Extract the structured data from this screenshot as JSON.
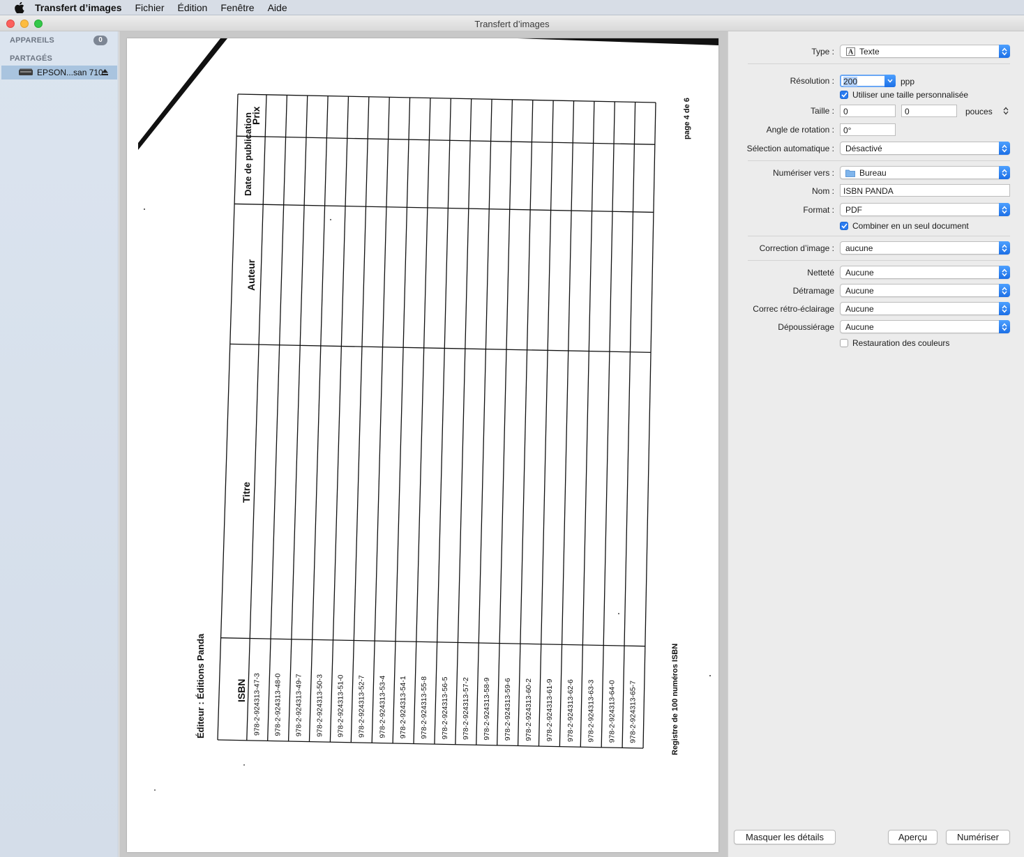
{
  "menubar": {
    "app_name": "Transfert d’images",
    "items": [
      "Fichier",
      "Édition",
      "Fenêtre",
      "Aide"
    ]
  },
  "window": {
    "title": "Transfert d’images"
  },
  "sidebar": {
    "devices_title": "APPAREILS",
    "devices_count": "0",
    "shared_title": "PARTAGÉS",
    "shared_device": "EPSON...san 710"
  },
  "document": {
    "page_label": "page 4 de 6",
    "publisher": "Éditeur : Éditions Panda",
    "registry": "Registre de 100 numéros ISBN",
    "headers": {
      "isbn": "ISBN",
      "title": "Titre",
      "author": "Auteur",
      "date": "Date de publication",
      "price": "Prix"
    },
    "isbns": [
      "978-2-924313-47-3",
      "978-2-924313-48-0",
      "978-2-924313-49-7",
      "978-2-924313-50-3",
      "978-2-924313-51-0",
      "978-2-924313-52-7",
      "978-2-924313-53-4",
      "978-2-924313-54-1",
      "978-2-924313-55-8",
      "978-2-924313-56-5",
      "978-2-924313-57-2",
      "978-2-924313-58-9",
      "978-2-924313-59-6",
      "978-2-924313-60-2",
      "978-2-924313-61-9",
      "978-2-924313-62-6",
      "978-2-924313-63-3",
      "978-2-924313-64-0",
      "978-2-924313-65-7"
    ]
  },
  "settings": {
    "type": {
      "label": "Type :",
      "value": "Texte"
    },
    "resolution": {
      "label": "Résolution :",
      "value": "200",
      "unit": "ppp"
    },
    "custom_size": {
      "label": "Utiliser une taille personnalisée",
      "checked": true
    },
    "size": {
      "label": "Taille :",
      "width": "0",
      "height": "0",
      "unit": "pouces"
    },
    "rotation": {
      "label": "Angle de rotation :",
      "value": "0°"
    },
    "auto_select": {
      "label": "Sélection automatique :",
      "value": "Désactivé"
    },
    "scan_to": {
      "label": "Numériser vers :",
      "value": "Bureau"
    },
    "name": {
      "label": "Nom :",
      "value": "ISBN PANDA"
    },
    "format": {
      "label": "Format :",
      "value": "PDF"
    },
    "combine": {
      "label": "Combiner en un seul document",
      "checked": true
    },
    "correction": {
      "label": "Correction d’image :",
      "value": "aucune"
    },
    "sharpness": {
      "label": "Netteté",
      "value": "Aucune"
    },
    "descreen": {
      "label": "Détramage",
      "value": "Aucune"
    },
    "backlight": {
      "label": "Correc rétro-éclairage",
      "value": "Aucune"
    },
    "dust": {
      "label": "Dépoussiérage",
      "value": "Aucune"
    },
    "color_restore": {
      "label": "Restauration des couleurs",
      "checked": false
    }
  },
  "buttons": {
    "hide_details": "Masquer les détails",
    "preview": "Aperçu",
    "scan": "Numériser"
  },
  "colors": {
    "accent": "#2a7cf0",
    "sidebar_selected": "#a9c4df",
    "close": "#fc605c",
    "minimize": "#fdbc40",
    "zoom": "#34c84a"
  }
}
